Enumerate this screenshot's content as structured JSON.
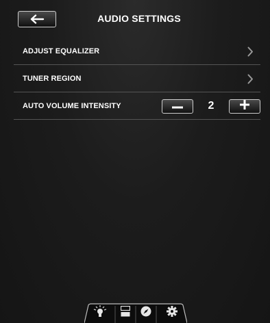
{
  "header": {
    "title": "AUDIO SETTINGS",
    "back_icon": "arrow-left-icon"
  },
  "settings": {
    "adjust_equalizer": {
      "label": "ADJUST EQUALIZER",
      "icon": "chevron-right-icon"
    },
    "tuner_region": {
      "label": "TUNER REGION",
      "icon": "chevron-right-icon"
    },
    "auto_volume": {
      "label": "AUTO VOLUME INTENSITY",
      "value": "2",
      "decrease_icon": "minus-icon",
      "increase_icon": "plus-icon"
    }
  },
  "bottom_nav": {
    "items": [
      {
        "icon": "lightbulb-icon"
      },
      {
        "icon": "panels-icon"
      },
      {
        "icon": "compass-icon"
      },
      {
        "icon": "gear-icon"
      }
    ]
  },
  "colors": {
    "background": "#1c1c1c",
    "text": "#ffffff",
    "divider": "#555555",
    "button_border": "#cfcfcf"
  }
}
